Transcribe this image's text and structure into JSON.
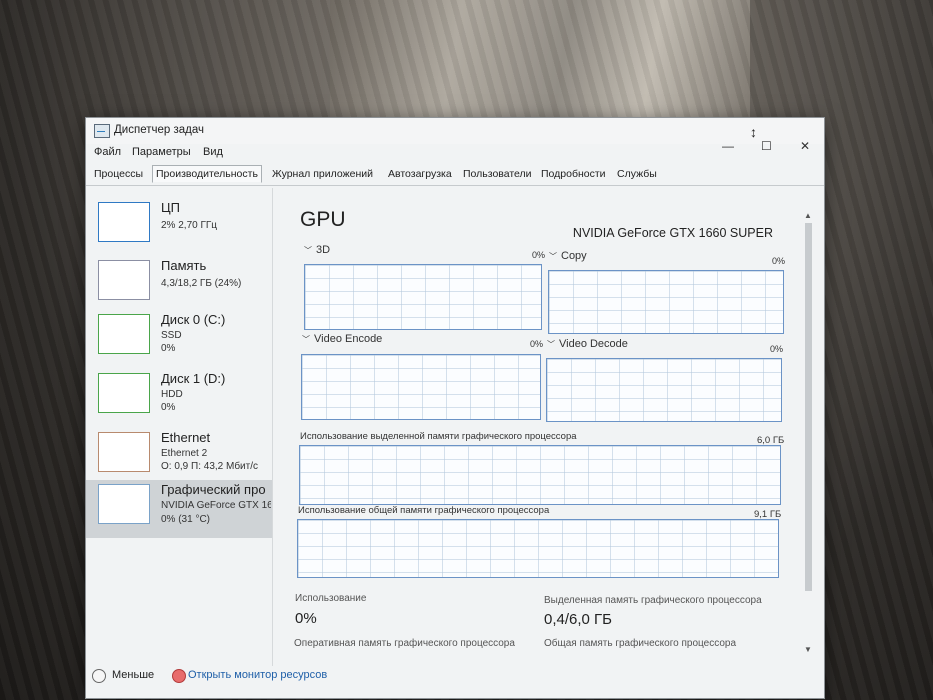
{
  "window": {
    "title": "Диспетчер задач"
  },
  "menu": {
    "file": "Файл",
    "options": "Параметры",
    "view": "Вид"
  },
  "tabs": [
    "Процессы",
    "Производительность",
    "Журнал приложений",
    "Автозагрузка",
    "Пользователи",
    "Подробности",
    "Службы"
  ],
  "active_tab": "Производительность",
  "sidebar": {
    "items": [
      {
        "title": "ЦП",
        "sub1": "2% 2,70 ГГц",
        "sub2": "",
        "color": "#2f79c4"
      },
      {
        "title": "Память",
        "sub1": "4,3/18,2 ГБ (24%)",
        "sub2": "",
        "color": "#8b8fa3"
      },
      {
        "title": "Диск 0 (C:)",
        "sub1": "SSD",
        "sub2": "0%",
        "color": "#4aa54a"
      },
      {
        "title": "Диск 1 (D:)",
        "sub1": "HDD",
        "sub2": "0%",
        "color": "#4aa54a"
      },
      {
        "title": "Ethernet",
        "sub1": "Ethernet 2",
        "sub2": "О: 0,9 П: 43,2 Мбит/с",
        "color": "#b88a6e"
      },
      {
        "title": "Графический про",
        "sub1": "NVIDIA GeForce GTX 166",
        "sub2": "0% (31 °C)",
        "color": "#7aa2c8"
      }
    ]
  },
  "gpu": {
    "title": "GPU",
    "name": "NVIDIA GeForce GTX 1660 SUPER",
    "engines": [
      {
        "label": "3D",
        "pct": "0%"
      },
      {
        "label": "Copy",
        "pct": "0%"
      },
      {
        "label": "Video Encode",
        "pct": "0%"
      },
      {
        "label": "Video Decode",
        "pct": "0%"
      }
    ],
    "dedicated_mem_label": "Использование выделенной памяти графического процессора",
    "dedicated_mem_max": "6,0 ГБ",
    "shared_mem_label": "Использование общей памяти графического процессора",
    "shared_mem_max": "9,1 ГБ",
    "stats": {
      "usage_label": "Использование",
      "usage_value": "0%",
      "dedicated_label": "Выделенная память графического процессора",
      "dedicated_value": "0,4/6,0 ГБ",
      "gpu_ram_label": "Оперативная память графического процессора",
      "shared_label": "Общая память графического процессора"
    }
  },
  "footer": {
    "less": "Меньше",
    "resource_monitor": "Открыть монитор ресурсов"
  },
  "colors": {
    "graph_border": "#6b93c6",
    "accent": "#2f79c4"
  }
}
